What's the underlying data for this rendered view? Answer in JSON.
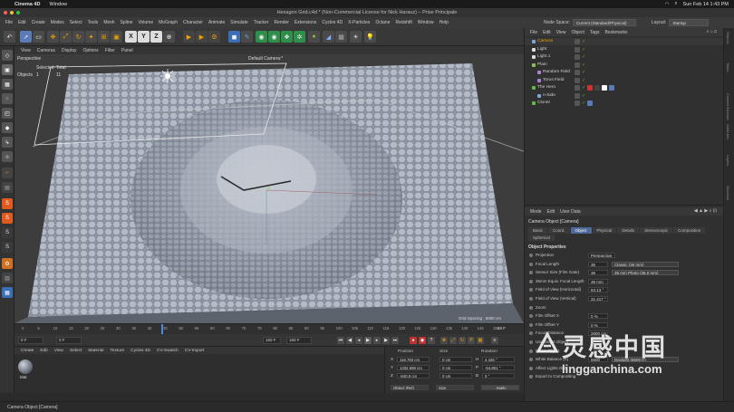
{
  "mac_menubar": {
    "app_name": "Cinema 4D",
    "items": [
      "Window"
    ],
    "clock": "Sun Feb 14  1:43 PM"
  },
  "window": {
    "title": "Hexagon Grid.c4d * (Non-Commercial License for Nick Harauz) – Prise Principale"
  },
  "main_menu": {
    "items": [
      "File",
      "Edit",
      "Create",
      "Modes",
      "Select",
      "Tools",
      "Mesh",
      "Spline",
      "Volume",
      "MoGraph",
      "Character",
      "Animate",
      "Simulate",
      "Tracker",
      "Render",
      "Extensions",
      "Cycles 4D",
      "X-Particles",
      "Octane",
      "Redshift",
      "Window",
      "Help"
    ],
    "node_space_label": "Node Space:",
    "node_space_value": "Current (Standard/Physical)",
    "layout_label": "Layout:",
    "layout_value": "Startup"
  },
  "toolbar": {
    "axis_x": "X",
    "axis_y": "Y",
    "axis_z": "Z"
  },
  "viewport": {
    "menu": [
      "View",
      "Cameras",
      "Display",
      "Options",
      "Filter",
      "Panel"
    ],
    "projection": "Perspective",
    "camera_name": "Default Camera:*",
    "selected_label": "Selected",
    "total_label": "Total",
    "objects_label": "Objects",
    "selected_count": "1",
    "total_count": "11",
    "grid_spacing": "Grid Spacing : 5000 cm"
  },
  "timeline": {
    "ticks": [
      "0",
      "5",
      "10",
      "15",
      "20",
      "25",
      "30",
      "35",
      "40",
      "45",
      "50",
      "55",
      "60",
      "65",
      "70",
      "75",
      "80",
      "85",
      "90",
      "95",
      "100",
      "105",
      "110",
      "115",
      "120",
      "125",
      "130",
      "135",
      "140",
      "145",
      "150"
    ],
    "current_frame": "48 F",
    "start_frame": "0 F",
    "min_frame": "0 F",
    "end_frame": "150 F",
    "max_frame": "150 F"
  },
  "material_manager": {
    "menu": [
      "Create",
      "Edit",
      "View",
      "Select",
      "Material",
      "Texture",
      "Cycles 4D",
      "CV-Swatch",
      "CV-Import"
    ],
    "material_name": "Mat"
  },
  "coordinates": {
    "header_position": "Position",
    "header_size": "Size",
    "header_rotation": "Rotation",
    "rows": [
      {
        "axis": "X",
        "pos": "116.783 cm",
        "size": "0 cm",
        "rot_axis": "H",
        "rot": "4.426 °"
      },
      {
        "axis": "Y",
        "pos": "1332.698 cm",
        "size": "0 cm",
        "rot_axis": "P",
        "rot": "-54.801 °"
      },
      {
        "axis": "Z",
        "pos": "-840.8 cm",
        "size": "0 cm",
        "rot_axis": "B",
        "rot": "0 °"
      }
    ],
    "mode_value": "Object (Rel)",
    "size_mode": "Size",
    "apply_label": "Apply"
  },
  "object_manager": {
    "menu": [
      "File",
      "Edit",
      "View",
      "Object",
      "Tags",
      "Bookmarks"
    ],
    "objects": [
      {
        "name": "Camera",
        "indent": 0,
        "selected": true
      },
      {
        "name": "Light",
        "indent": 0,
        "selected": false
      },
      {
        "name": "Light.1",
        "indent": 0,
        "selected": false
      },
      {
        "name": "Plain",
        "indent": 0,
        "selected": false
      },
      {
        "name": "Random Field",
        "indent": 1,
        "selected": false
      },
      {
        "name": "Torus Field",
        "indent": 1,
        "selected": false
      },
      {
        "name": "The Hero",
        "indent": 0,
        "selected": false
      },
      {
        "name": "n-Side",
        "indent": 1,
        "selected": false
      },
      {
        "name": "Cloner",
        "indent": 0,
        "selected": false
      }
    ]
  },
  "attributes": {
    "menu": [
      "Mode",
      "Edit",
      "User Data"
    ],
    "title": "Camera Object [Camera]",
    "tabs": [
      "Basic",
      "Coord.",
      "Object",
      "Physical",
      "Details",
      "Stereoscopic",
      "Composition",
      "Spherical"
    ],
    "active_tab": "Object",
    "section": "Object Properties",
    "props": [
      {
        "label": "Projection",
        "value": "Perspective",
        "extra": ""
      },
      {
        "label": "Focal Length",
        "value": "36",
        "extra": "Classic (36 mm)"
      },
      {
        "label": "Sensor Size (Film Gate)",
        "value": "36",
        "extra": "35 mm Photo (36.0 mm)"
      },
      {
        "label": "35mm Equiv. Focal Length:",
        "value": "36 mm",
        "extra": ""
      },
      {
        "label": "Field of View (Horizontal)",
        "value": "53.13 °",
        "extra": ""
      },
      {
        "label": "Field of View (Vertical)",
        "value": "31.417 °",
        "extra": ""
      },
      {
        "label": "Zoom",
        "value": "",
        "extra": ""
      },
      {
        "label": "Film Offset X",
        "value": "0 %",
        "extra": ""
      },
      {
        "label": "Film Offset Y",
        "value": "0 %",
        "extra": ""
      },
      {
        "label": "Focus Distance",
        "value": "2000 cm",
        "extra": ""
      },
      {
        "label": "Use Target Object",
        "value": "",
        "extra": ""
      },
      {
        "label": "Focus Object",
        "value": "",
        "extra": ""
      },
      {
        "label": "White Balance (K)",
        "value": "6500",
        "extra": "Daylight (6500 K)"
      },
      {
        "label": "Affect Lights Only",
        "value": "",
        "extra": ""
      },
      {
        "label": "Export to Compositing",
        "value": "",
        "extra": ""
      }
    ]
  },
  "right_strip": [
    "Objects",
    "Takes",
    "Content Browser",
    "Attributes",
    "Layers",
    "Structure"
  ],
  "status": {
    "text": "Camera Object [Camera]"
  },
  "watermark": {
    "chinese": "灵感中国",
    "url": "lingganchina.com"
  },
  "colors": {
    "accent_blue": "#4d6a9a",
    "selected_orange": "#f0a000",
    "tag_green": "#5fbf3f"
  }
}
